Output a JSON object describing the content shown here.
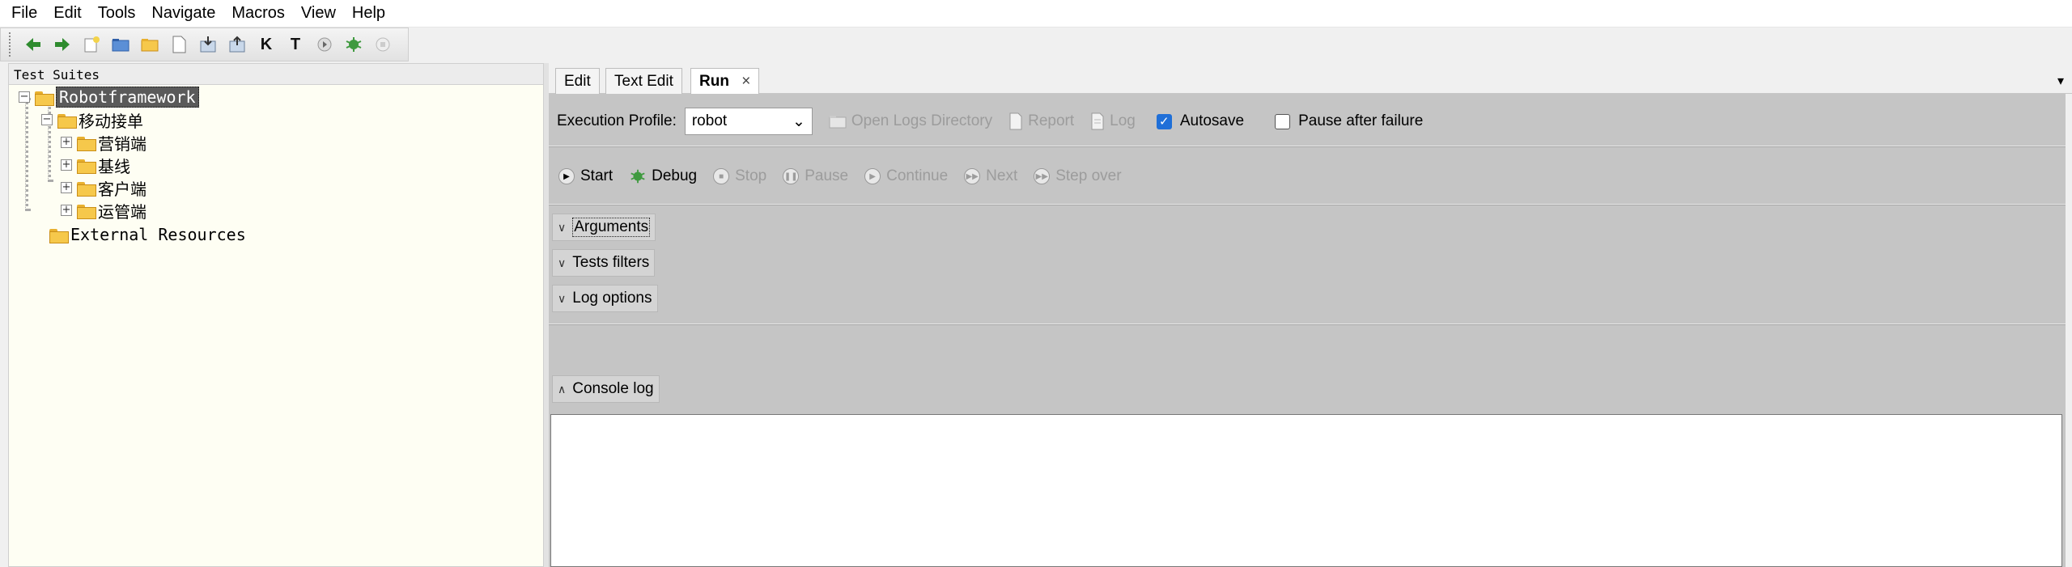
{
  "menu": [
    "File",
    "Edit",
    "Tools",
    "Navigate",
    "Macros",
    "View",
    "Help"
  ],
  "toolbar": {
    "icons": [
      "arrow-left-icon",
      "arrow-right-icon",
      "new-project-icon",
      "open-folder-icon",
      "open-directory-icon",
      "new-file-icon",
      "save-icon",
      "save-all-icon",
      "search-keywords-icon",
      "search-tests-icon",
      "run-icon",
      "debug-icon",
      "stop-icon"
    ],
    "k_label": "K",
    "t_label": "T"
  },
  "left_pane": {
    "title": "Test Suites",
    "tree": {
      "root": "Robotframework",
      "child": "移动接单",
      "suites": [
        "营销端",
        "基线",
        "客户端",
        "运管端"
      ],
      "external": "External Resources"
    }
  },
  "tabs": [
    {
      "label": "Edit"
    },
    {
      "label": "Text Edit"
    },
    {
      "label": "Run"
    }
  ],
  "tab_close_glyph": "×",
  "tab_menu_glyph": "▾",
  "run": {
    "profile_label": "Execution Profile:",
    "profile_value": "robot",
    "open_logs": "Open Logs Directory",
    "report": "Report",
    "log": "Log",
    "autosave": "Autosave",
    "autosave_checked": true,
    "pause_after_failure": "Pause after failure",
    "pause_checked": false,
    "buttons": {
      "start": "Start",
      "debug": "Debug",
      "stop": "Stop",
      "pause": "Pause",
      "continue": "Continue",
      "next": "Next",
      "step_over": "Step over"
    },
    "sections": {
      "arguments": "Arguments",
      "tests_filters": "Tests filters",
      "log_options": "Log options",
      "console_log": "Console log"
    }
  },
  "colors": {
    "tree_background": "#fefef3",
    "run_panel": "#c5c5c5",
    "checkbox_accent": "#1f6fd8"
  }
}
